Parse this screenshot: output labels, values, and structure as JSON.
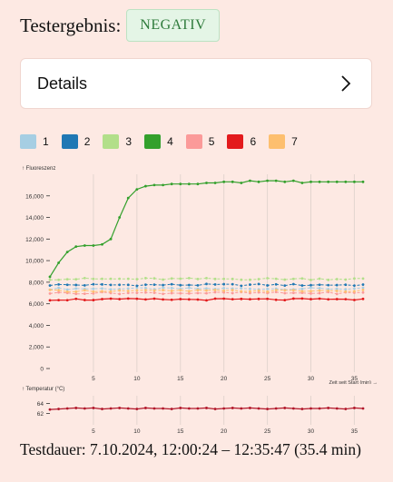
{
  "result": {
    "label": "Testergebnis:",
    "value": "NEGATIV"
  },
  "details": {
    "label": "Details",
    "chevron_icon": "chevron-right-icon"
  },
  "legend": [
    {
      "label": "1",
      "color": "#a6cee3"
    },
    {
      "label": "2",
      "color": "#1f78b4"
    },
    {
      "label": "3",
      "color": "#b2df8a"
    },
    {
      "label": "4",
      "color": "#33a02c"
    },
    {
      "label": "5",
      "color": "#fb9a99"
    },
    {
      "label": "6",
      "color": "#e31a1c"
    },
    {
      "label": "7",
      "color": "#fdbf6f"
    }
  ],
  "chart_data": [
    {
      "type": "line",
      "ylabel": "↑ Fluoreszenz",
      "xlabel": "Zeit seit Start (min) →",
      "xlim": [
        0,
        36
      ],
      "ylim": [
        0,
        18000
      ],
      "x_ticks": [
        5,
        10,
        15,
        20,
        25,
        30,
        35
      ],
      "y_ticks": [
        0,
        2000,
        4000,
        6000,
        8000,
        10000,
        12000,
        14000,
        16000
      ],
      "y_tick_labels": [
        "0",
        "2,000",
        "4,000",
        "6,000",
        "8,000",
        "10,000",
        "12,000",
        "14,000",
        "16,000"
      ],
      "grid": "vertical",
      "series": [
        {
          "name": "1",
          "color": "#a6cee3",
          "base": 7400,
          "dashed": true
        },
        {
          "name": "2",
          "color": "#1f78b4",
          "base": 7750,
          "dashed": true
        },
        {
          "name": "3",
          "color": "#b2df8a",
          "base": 8300,
          "dashed": true
        },
        {
          "name": "4",
          "color": "#33a02c",
          "dashed": false,
          "x": [
            0,
            1,
            2,
            3,
            4,
            5,
            6,
            7,
            8,
            9,
            10,
            11,
            12,
            13,
            14,
            15,
            16,
            17,
            18,
            19,
            20,
            21,
            22,
            23,
            24,
            25,
            26,
            27,
            28,
            29,
            30,
            31,
            32,
            33,
            34,
            35,
            36
          ],
          "values": [
            8500,
            9800,
            10800,
            11300,
            11400,
            11400,
            11500,
            12000,
            14000,
            15800,
            16600,
            16900,
            17000,
            17000,
            17100,
            17100,
            17100,
            17100,
            17200,
            17200,
            17300,
            17300,
            17200,
            17400,
            17300,
            17400,
            17400,
            17300,
            17400,
            17200,
            17300,
            17300,
            17300,
            17300,
            17300,
            17300,
            17300
          ]
        },
        {
          "name": "5",
          "color": "#fb9a99",
          "base": 7000,
          "dashed": true
        },
        {
          "name": "6",
          "color": "#e31a1c",
          "base": 6400,
          "dashed": false
        },
        {
          "name": "7",
          "color": "#fdbf6f",
          "base": 7200,
          "dashed": true
        }
      ]
    },
    {
      "type": "line",
      "ylabel": "↑ Temperatur (°C)",
      "xlim": [
        0,
        36
      ],
      "ylim": [
        60.5,
        65.5
      ],
      "y_ticks": [
        62,
        64
      ],
      "x_ticks": [
        5,
        10,
        15,
        20,
        25,
        30,
        35
      ],
      "grid": "vertical",
      "series": [
        {
          "name": "Temperatur",
          "color": "#b2182b",
          "x": [
            0,
            1,
            2,
            3,
            4,
            5,
            6,
            7,
            8,
            9,
            10,
            11,
            12,
            13,
            14,
            15,
            16,
            17,
            18,
            19,
            20,
            21,
            22,
            23,
            24,
            25,
            26,
            27,
            28,
            29,
            30,
            31,
            32,
            33,
            34,
            35,
            36
          ],
          "values": [
            62.8,
            62.9,
            63.0,
            63.1,
            63.0,
            63.1,
            62.9,
            63.0,
            63.1,
            63.0,
            62.9,
            63.1,
            63.0,
            63.0,
            62.9,
            63.1,
            63.0,
            63.0,
            63.1,
            62.9,
            63.0,
            63.1,
            63.0,
            63.1,
            63.0,
            62.9,
            63.0,
            63.1,
            63.0,
            62.9,
            63.0,
            63.0,
            63.1,
            63.0,
            62.9,
            63.1,
            63.0
          ]
        }
      ]
    }
  ],
  "footer": {
    "text": "Testdauer: 7.10.2024, 12:00:24 – 12:35:47 (35.4 min)"
  }
}
